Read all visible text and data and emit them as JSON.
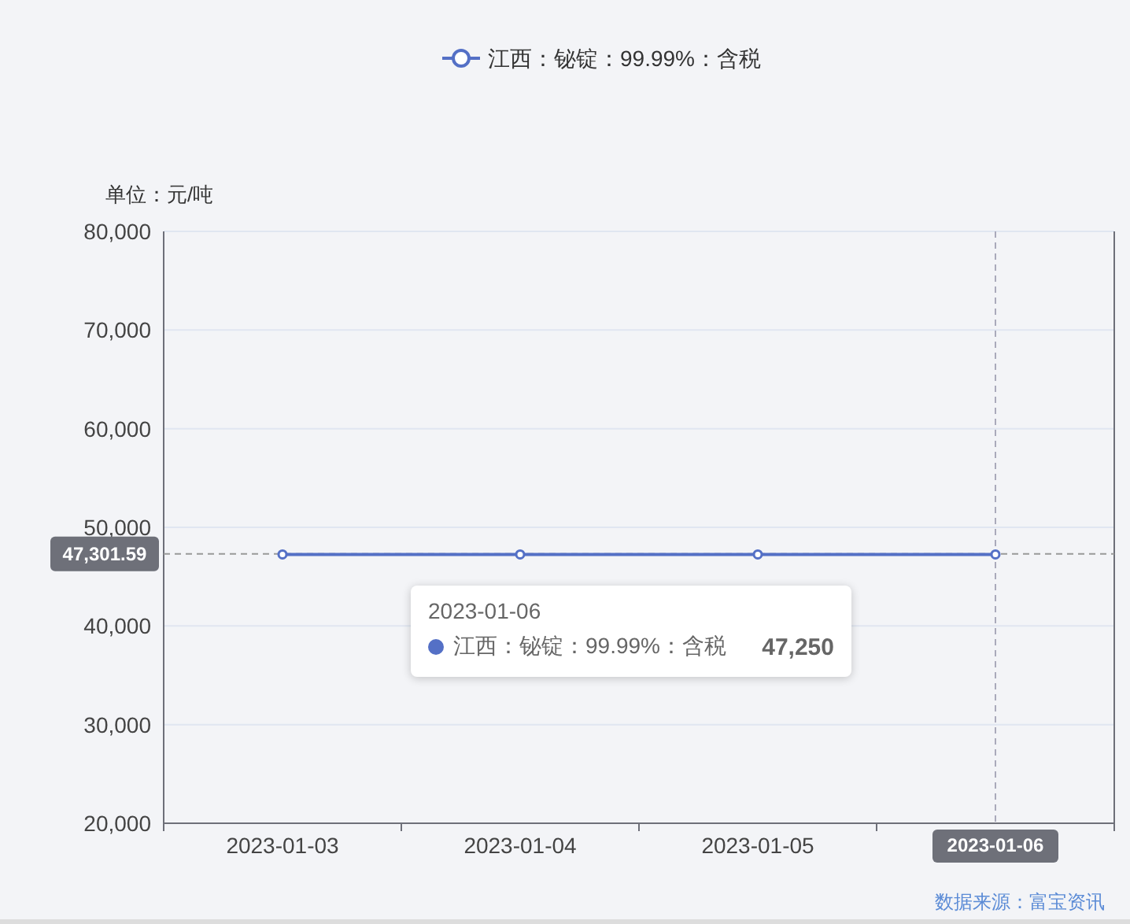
{
  "chart_data": {
    "type": "line",
    "ylabel": "单位：元/吨",
    "categories": [
      "2023-01-03",
      "2023-01-04",
      "2023-01-05",
      "2023-01-06"
    ],
    "series": [
      {
        "name": "江西：铋锭：99.99%：含税",
        "color": "#5470c6",
        "marker": "circle",
        "values": [
          47250,
          47250,
          47250,
          47250
        ]
      }
    ],
    "ylim": [
      20000,
      80000
    ],
    "grid": true,
    "yticks": [
      {
        "value": 20000,
        "label": "20,000"
      },
      {
        "value": 30000,
        "label": "30,000"
      },
      {
        "value": 40000,
        "label": "40,000"
      },
      {
        "value": 50000,
        "label": "50,000"
      },
      {
        "value": 60000,
        "label": "60,000"
      },
      {
        "value": 70000,
        "label": "70,000"
      },
      {
        "value": 80000,
        "label": "80,000"
      }
    ],
    "ref_lines": [
      {
        "axis": "y",
        "value": 47301.59,
        "label": "47,301.59"
      },
      {
        "axis": "x",
        "value": "2023-01-06",
        "label": "2023-01-06"
      }
    ]
  },
  "tooltip": {
    "title": "2023-01-06",
    "series": "江西：铋锭：99.99%：含税",
    "value": "47,250"
  },
  "source": "数据来源：富宝资讯"
}
